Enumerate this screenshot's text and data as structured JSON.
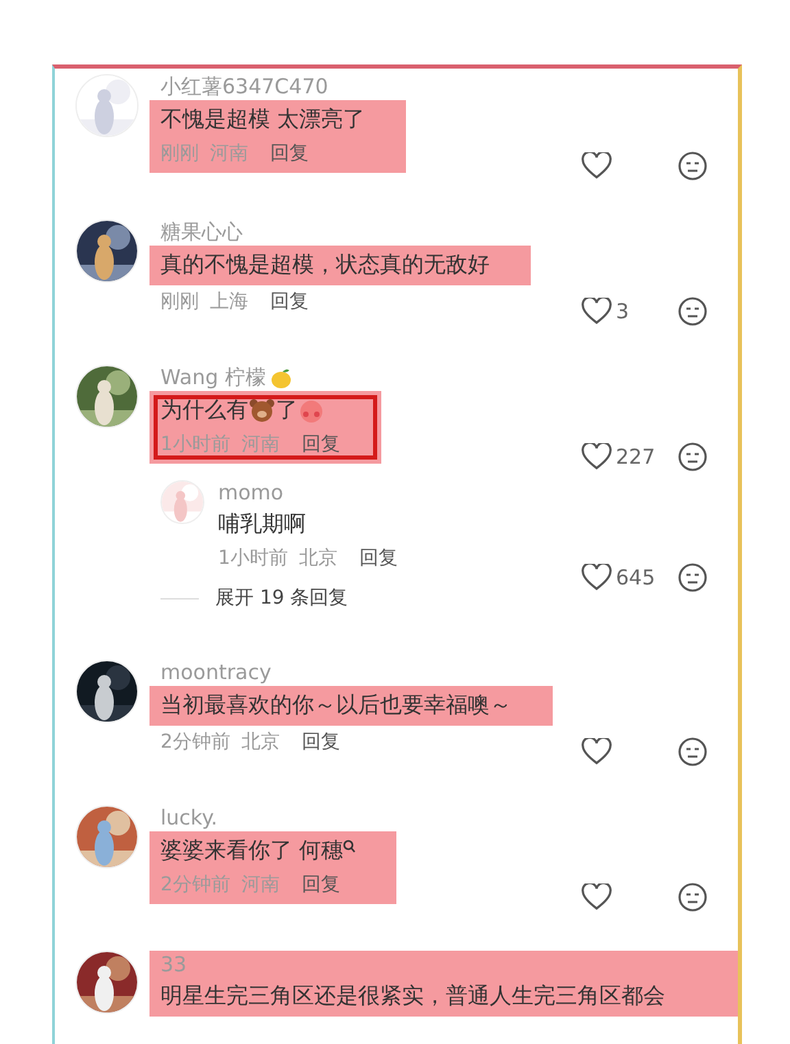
{
  "comments": [
    {
      "user": [
        {
          "kind": "text",
          "text": "小红薯6347C470"
        }
      ],
      "content": [
        {
          "kind": "text",
          "text": "不愧是超模 太漂亮了"
        }
      ],
      "time": "刚刚",
      "location": "河南",
      "reply": "回复",
      "name_highlighted": false,
      "text_highlighted": true,
      "meta_highlighted": true,
      "boxed": false
    },
    {
      "user": [
        {
          "kind": "text",
          "text": "糖果心心"
        }
      ],
      "content": [
        {
          "kind": "text",
          "text": "真的不愧是超模，状态真的无敌好"
        }
      ],
      "time": "刚刚",
      "location": "上海",
      "reply": "回复",
      "likes": "3",
      "name_highlighted": false,
      "text_highlighted": true,
      "meta_highlighted": false,
      "boxed": false
    },
    {
      "user": [
        {
          "kind": "text",
          "text": "Wang 柠檬"
        },
        {
          "kind": "lemon"
        }
      ],
      "content": [
        {
          "kind": "text",
          "text": "为什么有"
        },
        {
          "kind": "bear"
        },
        {
          "kind": "text",
          "text": "了"
        },
        {
          "kind": "blush"
        }
      ],
      "time": "1小时前",
      "location": "河南",
      "reply": "回复",
      "likes": "227",
      "name_highlighted": false,
      "text_highlighted": true,
      "meta_highlighted": true,
      "boxed": true,
      "replies": [
        {
          "user": [
            {
              "kind": "text",
              "text": "momo"
            }
          ],
          "content": [
            {
              "kind": "text",
              "text": "哺乳期啊"
            }
          ],
          "time": "1小时前",
          "location": "北京",
          "reply": "回复",
          "likes": "645",
          "name_highlighted": false,
          "text_highlighted": false,
          "meta_highlighted": false,
          "boxed": false
        }
      ],
      "expand": "展开 19 条回复"
    },
    {
      "user": [
        {
          "kind": "text",
          "text": "moontracy"
        }
      ],
      "content": [
        {
          "kind": "text",
          "text": "当初最喜欢的你～以后也要幸福噢～"
        }
      ],
      "time": "2分钟前",
      "location": "北京",
      "reply": "回复",
      "name_highlighted": false,
      "text_highlighted": true,
      "meta_highlighted": false,
      "boxed": false
    },
    {
      "user": [
        {
          "kind": "text",
          "text": "lucky."
        }
      ],
      "content": [
        {
          "kind": "text",
          "text": "婆婆来看你了 何穗"
        },
        {
          "kind": "search"
        }
      ],
      "time": "2分钟前",
      "location": "河南",
      "reply": "回复",
      "name_highlighted": false,
      "text_highlighted": true,
      "meta_highlighted": true,
      "boxed": false
    },
    {
      "user": [
        {
          "kind": "text",
          "text": "33"
        }
      ],
      "content": [
        {
          "kind": "text",
          "text": "明星生完三角区还是很紧实，普通人生完三角区都会"
        }
      ],
      "name_highlighted": true,
      "text_highlighted": true,
      "boxed": false
    }
  ]
}
